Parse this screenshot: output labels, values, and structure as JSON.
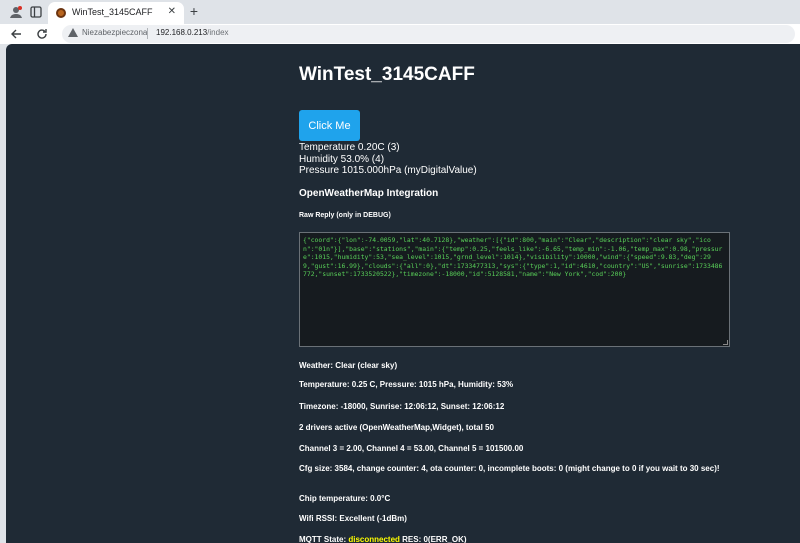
{
  "browser": {
    "tab_title": "WinTest_3145CAFF",
    "tab_close": "✕",
    "new_tab": "+",
    "security_label": "Niezabezpieczona",
    "url_host": "192.168.0.213",
    "url_path": "/index"
  },
  "page": {
    "title": "WinTest_3145CAFF",
    "button_label": "Click Me",
    "sensors": [
      "Temperature 0.20C (3)",
      "Humidity 53.0% (4)",
      "Pressure 1015.000hPa (myDigitalValue)"
    ],
    "section_title": "OpenWeatherMap Integration",
    "raw_label": "Raw Reply (only in DEBUG)",
    "raw_reply": "{\"coord\":{\"lon\":-74.0059,\"lat\":40.7128},\"weather\":[{\"id\":800,\"main\":\"Clear\",\"description\":\"clear sky\",\"icon\":\"01n\"}],\"base\":\"stations\",\"main\":{\"temp\":0.25,\"feels_like\":-6.65,\"temp_min\":-1.06,\"temp_max\":0.98,\"pressure\":1015,\"humidity\":53,\"sea_level\":1015,\"grnd_level\":1014},\"visibility\":10000,\"wind\":{\"speed\":9.83,\"deg\":299,\"gust\":16.99},\"clouds\":{\"all\":0},\"dt\":1733477313,\"sys\":{\"type\":1,\"id\":4610,\"country\":\"US\",\"sunrise\":1733486772,\"sunset\":1733520522},\"timezone\":-18000,\"id\":5128581,\"name\":\"New York\",\"cod\":200}",
    "weather": "Weather: Clear (clear sky)",
    "temp_line": "Temperature: 0.25 C, Pressure: 1015 hPa, Humidity: 53%",
    "timezone_line": "Timezone: -18000, Sunrise: 12:06:12, Sunset: 12:06:12",
    "drivers_line": "2 drivers active (OpenWeatherMap,Widget), total 50",
    "channels_line": "Channel 3 = 2.00, Channel 4 = 53.00, Channel 5 = 101500.00",
    "cfg_line": "Cfg size: 3584, change counter: 4, ota counter: 0, incomplete boots: 0 (might change to 0 if you wait to 30 sec)!",
    "chip_line": "Chip temperature: 0.0°C",
    "wifi_line": "Wifi RSSI: Excellent (-1dBm)",
    "mqtt_prefix": "MQTT State: ",
    "mqtt_state": "disconnected",
    "mqtt_suffix": " RES: 0(ERR_OK)"
  },
  "colors": {
    "page_bg": "#1f2a35",
    "button_bg": "#1fa3ec",
    "raw_text": "#59d059",
    "mqtt_state": "#ffff00"
  }
}
